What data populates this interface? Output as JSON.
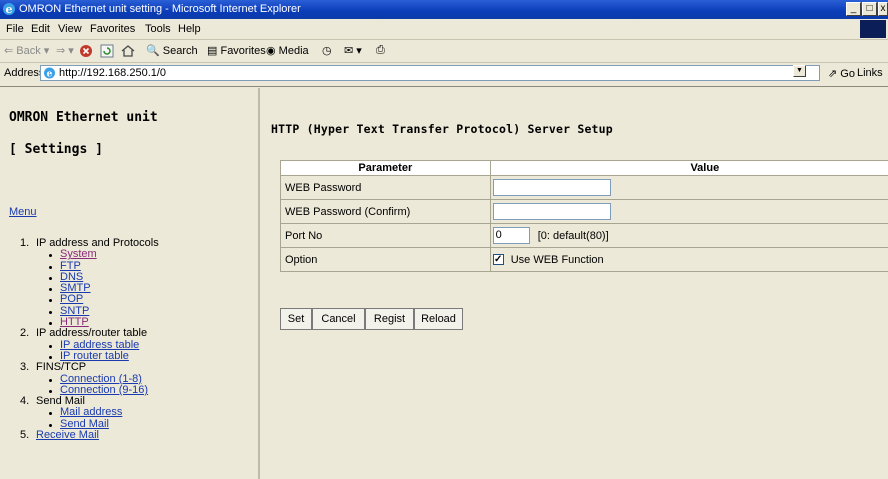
{
  "window": {
    "title": "OMRON Ethernet unit setting - Microsoft Internet Explorer",
    "controls": {
      "minimize": "_",
      "maximize": "□",
      "close": "x"
    }
  },
  "menubar": [
    "File",
    "Edit",
    "View",
    "Favorites",
    "Tools",
    "Help"
  ],
  "toolbar": {
    "back": "Back",
    "search": "Search",
    "favorites": "Favorites",
    "media": "Media"
  },
  "address": {
    "label": "Address",
    "url": "http://192.168.250.1/0",
    "go": "Go",
    "links": "Links"
  },
  "nav": {
    "heading": "OMRON Ethernet unit",
    "subheading": "[ Settings ]",
    "menu_link": "Menu",
    "sections": [
      {
        "num": "1.",
        "label": "IP address and Protocols",
        "items": [
          "System",
          "FTP",
          "DNS",
          "SMTP",
          "POP",
          "SNTP",
          "HTTP"
        ]
      },
      {
        "num": "2.",
        "label": "IP address/router table",
        "items": [
          "IP address table",
          "IP router table"
        ]
      },
      {
        "num": "3.",
        "label": "FINS/TCP",
        "items": [
          "Connection (1-8)",
          "Connection (9-16)"
        ]
      },
      {
        "num": "4.",
        "label": "Send Mail",
        "items": [
          "Mail address",
          "Send Mail"
        ]
      },
      {
        "num": "5.",
        "label": "Receive Mail",
        "items": []
      }
    ]
  },
  "main": {
    "title": "HTTP (Hyper Text Transfer Protocol) Server Setup",
    "table": {
      "headers": [
        "Parameter",
        "Value"
      ],
      "rows": [
        {
          "param": "WEB Password",
          "value": ""
        },
        {
          "param": "WEB Password (Confirm)",
          "value": ""
        },
        {
          "param": "Port No",
          "value": "0",
          "note": "[0: default(80)]"
        },
        {
          "param": "Option",
          "checkbox_label": "Use WEB Function",
          "checked": true
        }
      ]
    },
    "buttons": [
      "Set",
      "Cancel",
      "Regist",
      "Reload"
    ]
  }
}
